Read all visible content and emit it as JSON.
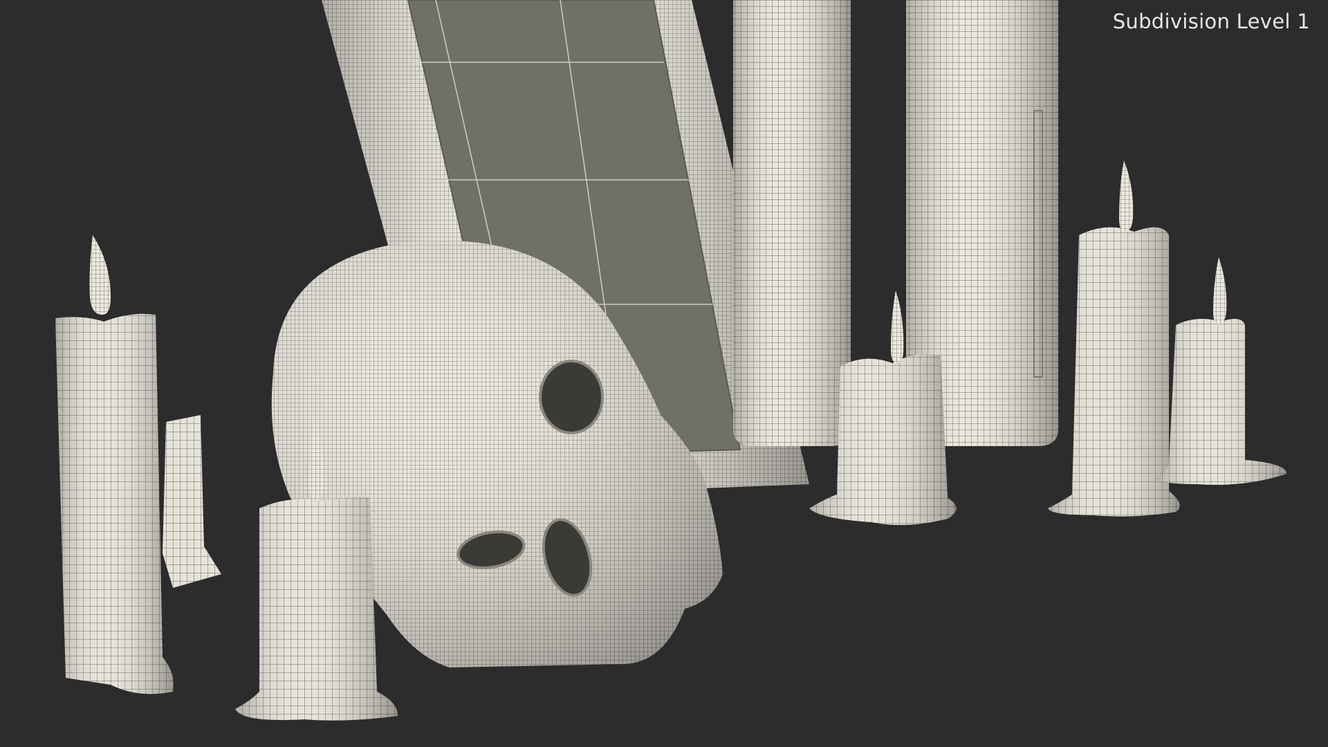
{
  "viewport": {
    "label": "Subdivision Level 1",
    "background": "#2c2c2c",
    "mesh_color": "#eae7dd",
    "wire_color": "#5a5a52",
    "mirror_color": "#6e6f66"
  }
}
